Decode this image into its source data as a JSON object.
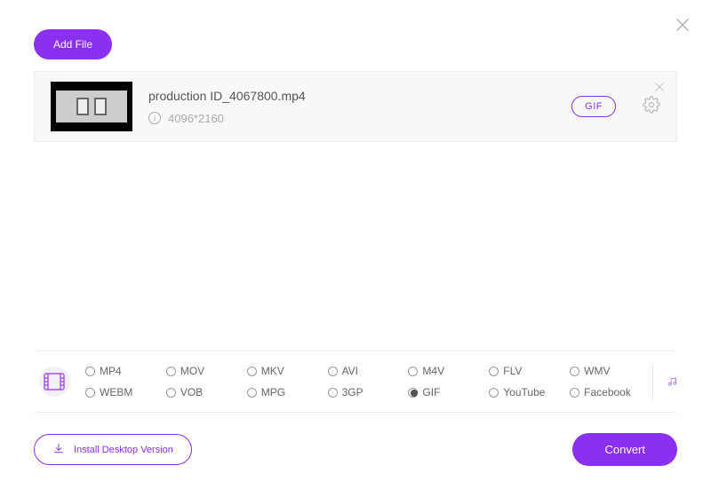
{
  "header": {
    "add_file_label": "Add File"
  },
  "file": {
    "name": "production ID_4067800.mp4",
    "dimensions": "4096*2160",
    "output_badge": "GIF"
  },
  "formats": {
    "rows": [
      [
        "MP4",
        "MOV",
        "MKV",
        "AVI",
        "M4V",
        "FLV",
        "WMV"
      ],
      [
        "WEBM",
        "VOB",
        "MPG",
        "3GP",
        "GIF",
        "YouTube",
        "Facebook"
      ]
    ],
    "selected": "GIF"
  },
  "footer": {
    "install_label": "Install Desktop Version",
    "convert_label": "Convert"
  },
  "colors": {
    "accent": "#8b2ff0"
  }
}
